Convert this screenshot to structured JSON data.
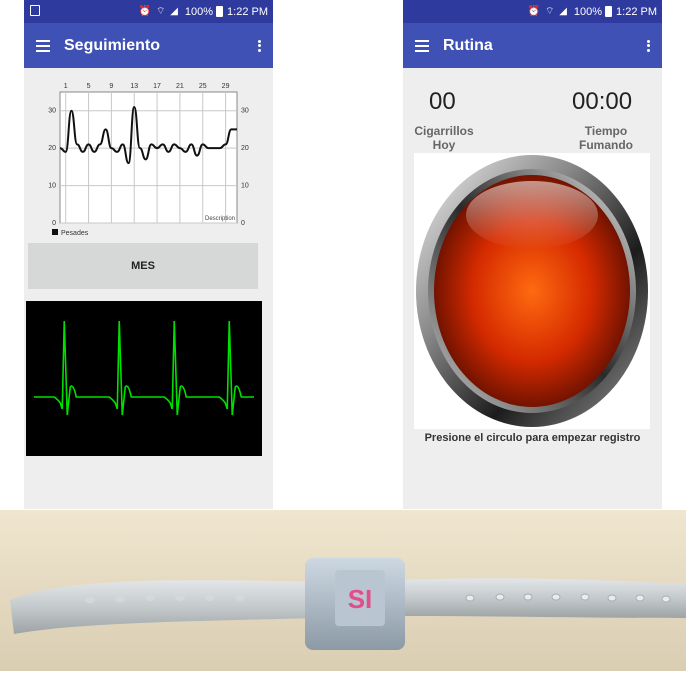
{
  "left_screen": {
    "status_bar": {
      "icons": "⏰ ⌔ ◢",
      "battery": "100%",
      "time": "1:22 PM"
    },
    "app_bar": {
      "title": "Seguimiento"
    },
    "chart_data": {
      "type": "line",
      "x_ticks": [
        1,
        5,
        9,
        13,
        17,
        21,
        25,
        29
      ],
      "y_ticks": [
        0,
        10,
        20,
        30
      ],
      "ylim": [
        0,
        35
      ],
      "xlim": [
        0,
        31
      ],
      "description_label": "Description",
      "grid": true,
      "legend": {
        "position": "bottom-left",
        "entries": [
          "Pesades"
        ]
      },
      "series": [
        {
          "name": "Pesades",
          "x": [
            0,
            1,
            2,
            3,
            4,
            5,
            6,
            7,
            8,
            9,
            10,
            11,
            12,
            13,
            14,
            15,
            16,
            17,
            18,
            19,
            20,
            21,
            22,
            23,
            24,
            25,
            26,
            27,
            28,
            29,
            30,
            31
          ],
          "y": [
            20,
            19,
            30,
            21,
            19,
            21,
            19,
            21,
            25,
            20,
            19,
            21,
            16,
            31,
            20,
            17,
            21,
            20,
            21,
            19,
            21,
            20,
            19,
            21,
            18,
            21,
            20,
            20,
            20,
            21,
            25,
            25
          ]
        }
      ]
    },
    "mes_button": {
      "label": "MES"
    },
    "ecg": {
      "color": "#00e000",
      "beats": 4
    }
  },
  "right_screen": {
    "status_bar": {
      "icons": "⏰ ⌔ ◢",
      "battery": "100%",
      "time": "1:22 PM"
    },
    "app_bar": {
      "title": "Rutina"
    },
    "cigarettes": {
      "value": "00",
      "label_line1": "Cigarrillos",
      "label_line2": "Hoy"
    },
    "smoking_time": {
      "value": "00:00",
      "label_line1": "Tiempo",
      "label_line2": "Fumando"
    },
    "record_hint": "Presione el circulo para empezar registro",
    "button_color": "#d42a00"
  },
  "photo": {
    "buckle_label": "SI",
    "band_color": "#c4c9cc",
    "background_color": "#e8dcc3"
  },
  "colors": {
    "status_bar": "#2f3a9e",
    "app_bar": "#3f51b5",
    "screen_bg": "#eeeeee",
    "chart_line": "#111111",
    "ecg_line": "#00e000"
  }
}
